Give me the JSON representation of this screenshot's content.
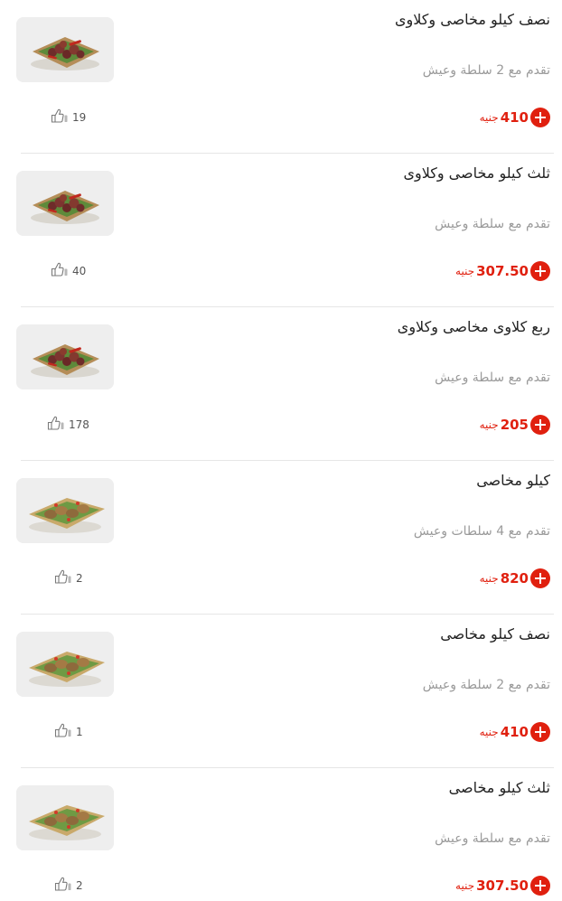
{
  "currency_label": "جنيه",
  "colors": {
    "accent": "#e0200f",
    "title": "#222222",
    "description": "#9a9a9a",
    "divider": "#e6e6e6"
  },
  "menu": {
    "items": [
      {
        "name": "نصف كيلو مخاصى وكلاوى",
        "description": "تقدم مع 2 سلطة وعيش",
        "price": "410",
        "likes": "19",
        "image_icon": "kebab-kofta-plate"
      },
      {
        "name": "ثلث كيلو مخاصى وكلاوى",
        "description": "تقدم مع سلطة وعيش",
        "price": "307.50",
        "likes": "40",
        "image_icon": "kebab-kofta-plate"
      },
      {
        "name": "ربع كلاوى مخاصى وكلاوى",
        "description": "تقدم مع سلطة وعيش",
        "price": "205",
        "likes": "178",
        "image_icon": "kebab-kofta-plate"
      },
      {
        "name": "كيلو مخاصى",
        "description": "تقدم مع 4 سلطات وعيش",
        "price": "820",
        "likes": "2",
        "image_icon": "grilled-rolls-plate"
      },
      {
        "name": "نصف كيلو مخاصى",
        "description": "تقدم مع 2 سلطة وعيش",
        "price": "410",
        "likes": "1",
        "image_icon": "grilled-rolls-plate"
      },
      {
        "name": "ثلث كيلو مخاصى",
        "description": "تقدم مع سلطة وعيش",
        "price": "307.50",
        "likes": "2",
        "image_icon": "grilled-rolls-plate"
      }
    ]
  }
}
